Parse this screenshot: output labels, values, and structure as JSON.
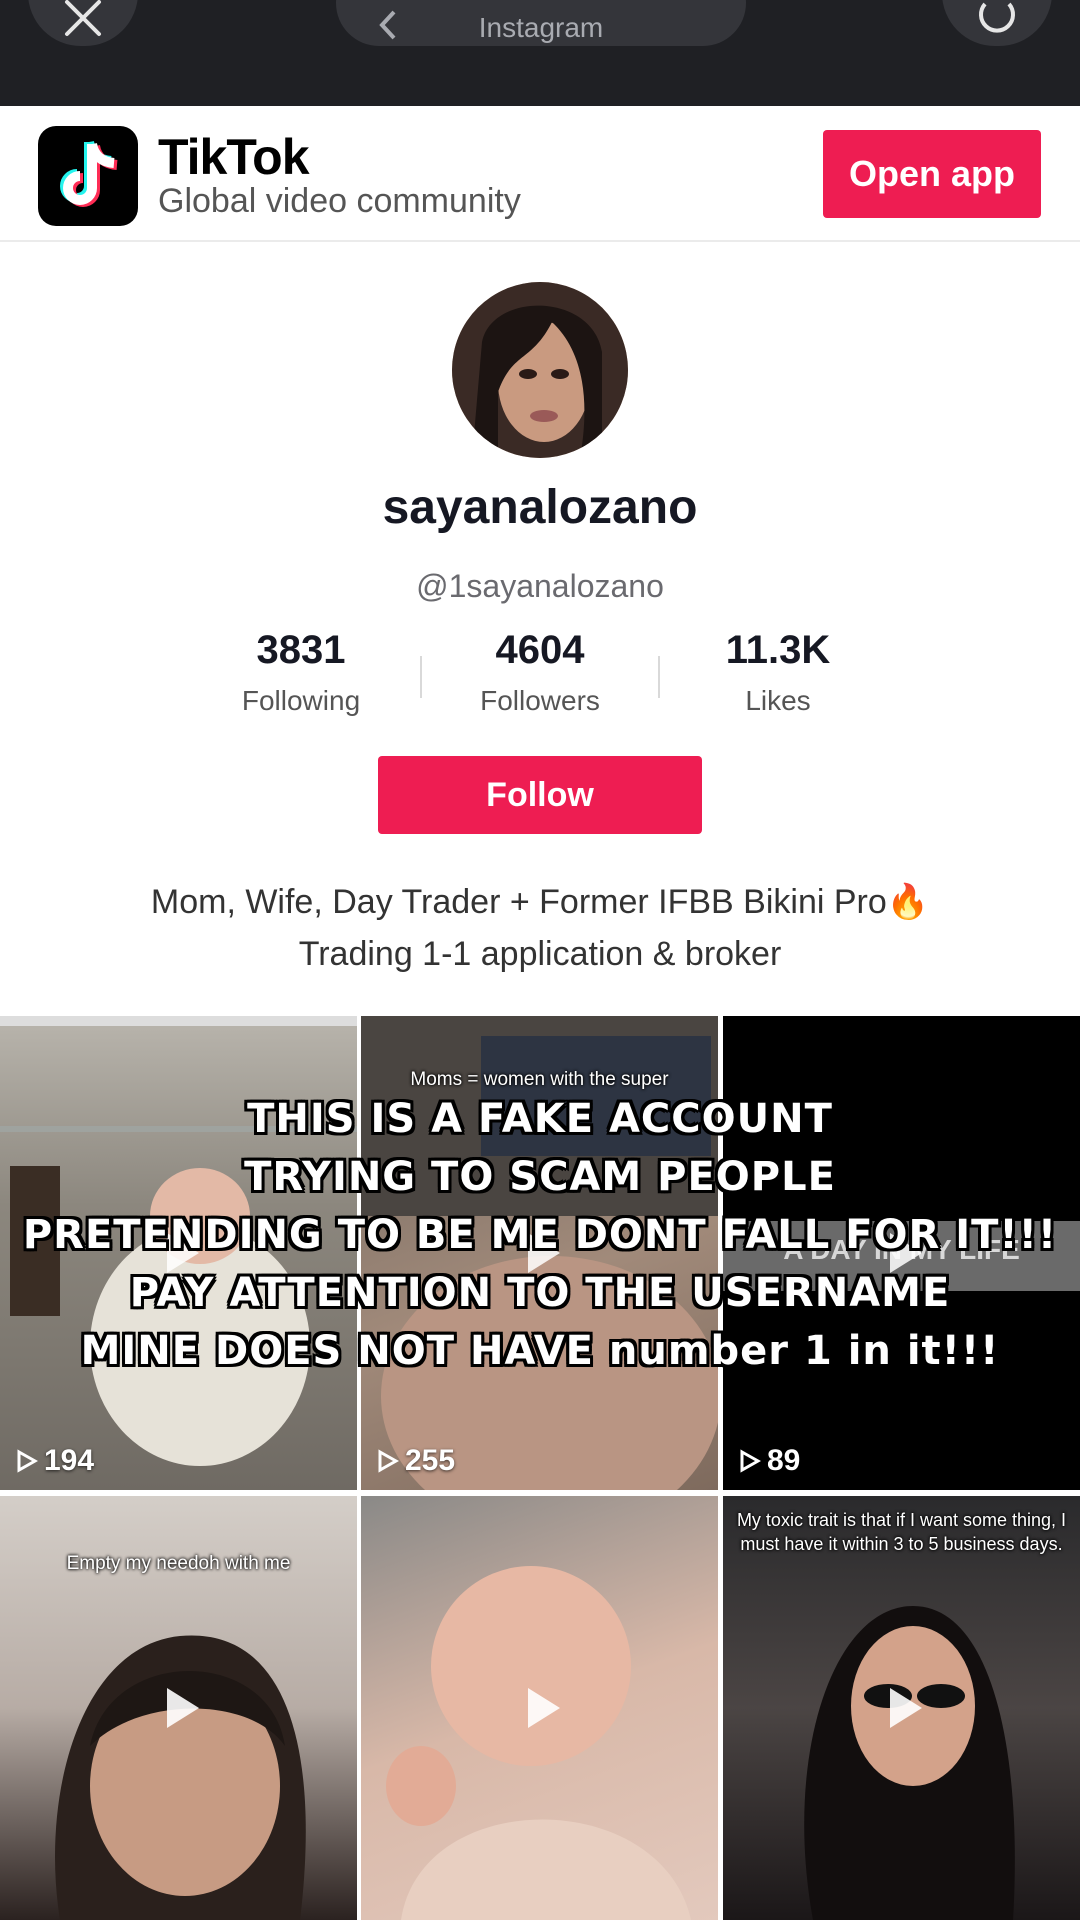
{
  "browser": {
    "address_text": "Instagram"
  },
  "banner": {
    "brand_name": "TikTok",
    "brand_tagline": "Global video community",
    "open_app_label": "Open app",
    "accent_color": "#ee1d52"
  },
  "profile": {
    "display_name": "sayanalozano",
    "handle": "@1sayanalozano",
    "stats": [
      {
        "value": "3831",
        "label": "Following"
      },
      {
        "value": "4604",
        "label": "Followers"
      },
      {
        "value": "11.3K",
        "label": "Likes"
      }
    ],
    "follow_label": "Follow",
    "bio_line1": "Mom, Wife, Day Trader + Former IFBB Bikini Pro🔥",
    "bio_line2": "Trading 1-1 application & broker"
  },
  "videos": [
    {
      "views": "194",
      "caption": ""
    },
    {
      "views": "255",
      "caption": "Moms = women with the super"
    },
    {
      "views": "89",
      "caption": "A DAY IN MY LIFE"
    },
    {
      "views": "",
      "caption": "Empty my needoh with me"
    },
    {
      "views": "",
      "caption": ""
    },
    {
      "views": "",
      "caption": "My toxic trait is that if I want some thing, I must have it within 3 to 5 business days."
    }
  ],
  "warning_overlay": {
    "line1": "THIS IS A FAKE ACCOUNT",
    "line2": "TRYING TO SCAM PEOPLE",
    "line3": "PRETENDING TO BE ME DONT FALL FOR IT!!!",
    "line4": "PAY ATTENTION TO THE USERNAME",
    "line5": "MINE DOES NOT HAVE number 1 in it!!!"
  }
}
